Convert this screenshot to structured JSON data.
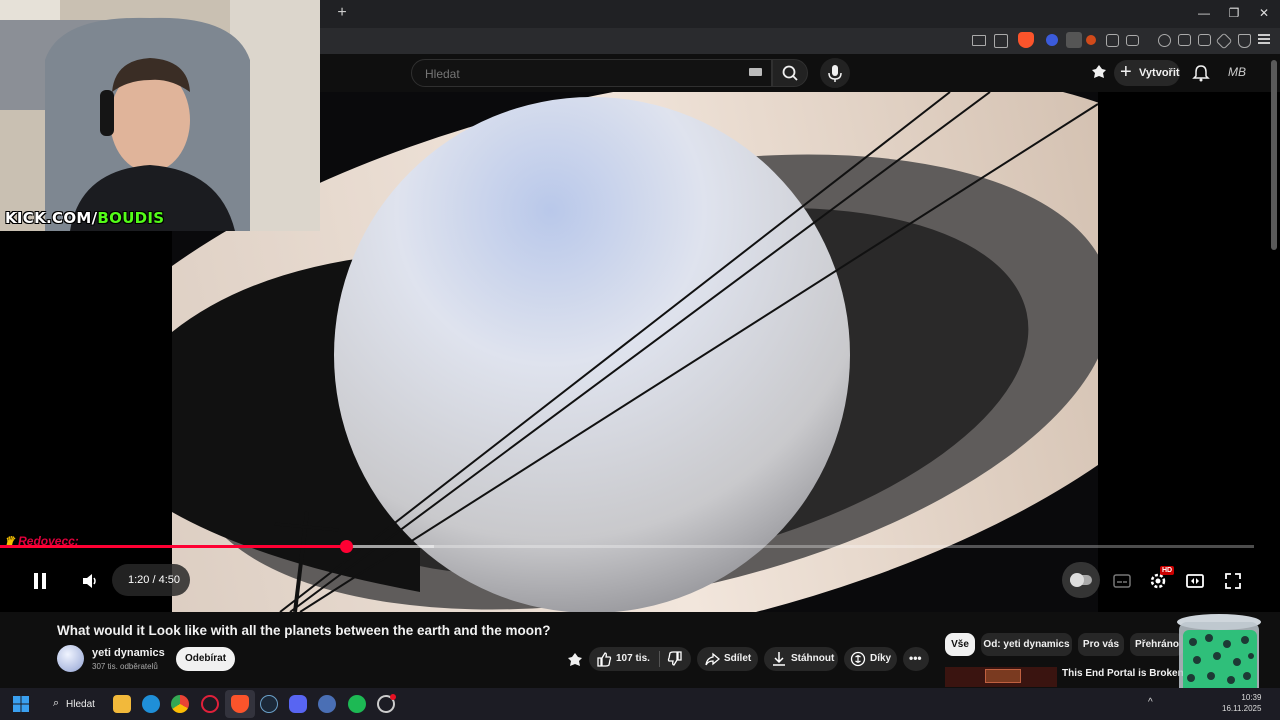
{
  "browser": {
    "new_tab_label": "+",
    "window_controls": [
      "—",
      "❐",
      "✕"
    ]
  },
  "header": {
    "search_placeholder": "Hledat",
    "create_label": "Vytvořit",
    "account_initials": "MB"
  },
  "overlay": {
    "watermark_prefix": "KICK.COM/",
    "watermark_name": "BOUDIS",
    "chat_user": "Redovecc:"
  },
  "player": {
    "time_display": "1:20 / 4:50",
    "progress_fraction": 0.2759,
    "hd_badge": "HD",
    "state": "playing"
  },
  "video": {
    "title": "What would it Look like with all the planets between the earth and the moon?",
    "channel_name": "yeti dynamics",
    "subscriber_count": "307 tis. odběratelů",
    "subscribe_label": "Odebírat",
    "likes": "107 tis.",
    "share_label": "Sdílet",
    "download_label": "Stáhnout",
    "thanks_label": "Díky"
  },
  "recommendations": {
    "chips": [
      "Vše",
      "Od: yeti dynamics",
      "Pro vás",
      "Přehráno"
    ],
    "first_title": "This End Portal is Broken, no what?"
  },
  "taskbar": {
    "search_label": "Hledat",
    "time": "10:39",
    "date": "16.11.2025"
  },
  "colors": {
    "accent_red": "#ff0033",
    "kick_green": "#53fc18",
    "background": "#0f0f0f"
  }
}
